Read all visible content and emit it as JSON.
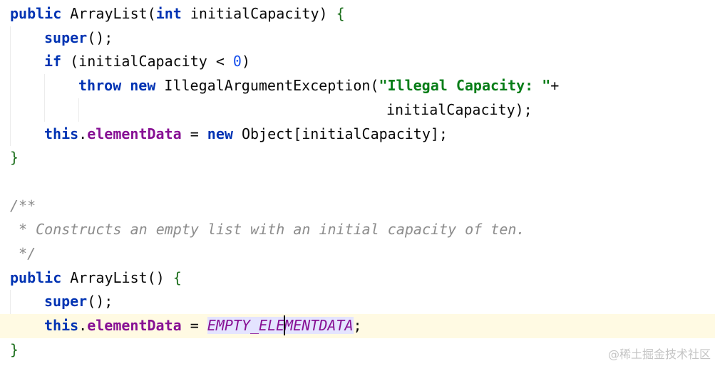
{
  "editor": {
    "lines": [
      {
        "indent": 0,
        "tokens": [
          {
            "t": "public",
            "k": "kw"
          },
          {
            "t": " ArrayList(",
            "k": ""
          },
          {
            "t": "int",
            "k": "kw"
          },
          {
            "t": " initialCapacity) ",
            "k": ""
          },
          {
            "t": "{",
            "k": "brace"
          }
        ]
      },
      {
        "indent": 1,
        "tokens": [
          {
            "t": "super",
            "k": "kw"
          },
          {
            "t": "();",
            "k": ""
          }
        ]
      },
      {
        "indent": 1,
        "tokens": [
          {
            "t": "if",
            "k": "kw"
          },
          {
            "t": " (initialCapacity < ",
            "k": ""
          },
          {
            "t": "0",
            "k": "num"
          },
          {
            "t": ")",
            "k": ""
          }
        ]
      },
      {
        "indent": 2,
        "tokens": [
          {
            "t": "throw",
            "k": "kw"
          },
          {
            "t": " ",
            "k": ""
          },
          {
            "t": "new",
            "k": "kw"
          },
          {
            "t": " IllegalArgumentException(",
            "k": ""
          },
          {
            "t": "\"Illegal Capacity: \"",
            "k": "str"
          },
          {
            "t": "+",
            "k": ""
          }
        ]
      },
      {
        "indent": 11,
        "tokens": [
          {
            "t": "initialCapacity);",
            "k": ""
          }
        ]
      },
      {
        "indent": 1,
        "tokens": [
          {
            "t": "this",
            "k": "kw"
          },
          {
            "t": ".",
            "k": ""
          },
          {
            "t": "elementData",
            "k": "field"
          },
          {
            "t": " = ",
            "k": ""
          },
          {
            "t": "new",
            "k": "kw"
          },
          {
            "t": " Object[initialCapacity];",
            "k": ""
          }
        ]
      },
      {
        "indent": 0,
        "tokens": [
          {
            "t": "}",
            "k": "brace"
          }
        ]
      },
      {
        "indent": 0,
        "tokens": []
      },
      {
        "indent": 0,
        "tokens": [
          {
            "t": "/**",
            "k": "cmt"
          }
        ]
      },
      {
        "indent": 0,
        "tokens": [
          {
            "t": " * Constructs an empty list with an initial capacity of ten.",
            "k": "cmt"
          }
        ]
      },
      {
        "indent": 0,
        "tokens": [
          {
            "t": " */",
            "k": "cmt"
          }
        ]
      },
      {
        "indent": 0,
        "tokens": [
          {
            "t": "public",
            "k": "kw"
          },
          {
            "t": " ArrayList() ",
            "k": ""
          },
          {
            "t": "{",
            "k": "brace"
          }
        ]
      },
      {
        "indent": 1,
        "tokens": [
          {
            "t": "super",
            "k": "kw"
          },
          {
            "t": "();",
            "k": ""
          }
        ]
      },
      {
        "indent": 1,
        "current": true,
        "tokens": [
          {
            "t": "this",
            "k": "kw"
          },
          {
            "t": ".",
            "k": ""
          },
          {
            "t": "elementData",
            "k": "field"
          },
          {
            "t": " = ",
            "k": ""
          },
          {
            "t": "EMPTY_ELE",
            "k": "const sel"
          },
          {
            "t": "|caret|",
            "k": "caret"
          },
          {
            "t": "MENTDATA",
            "k": "const sel"
          },
          {
            "t": ";",
            "k": ""
          }
        ]
      },
      {
        "indent": 0,
        "tokens": [
          {
            "t": "}",
            "k": "brace"
          }
        ]
      }
    ]
  },
  "watermark": "@稀土掘金技术社区"
}
